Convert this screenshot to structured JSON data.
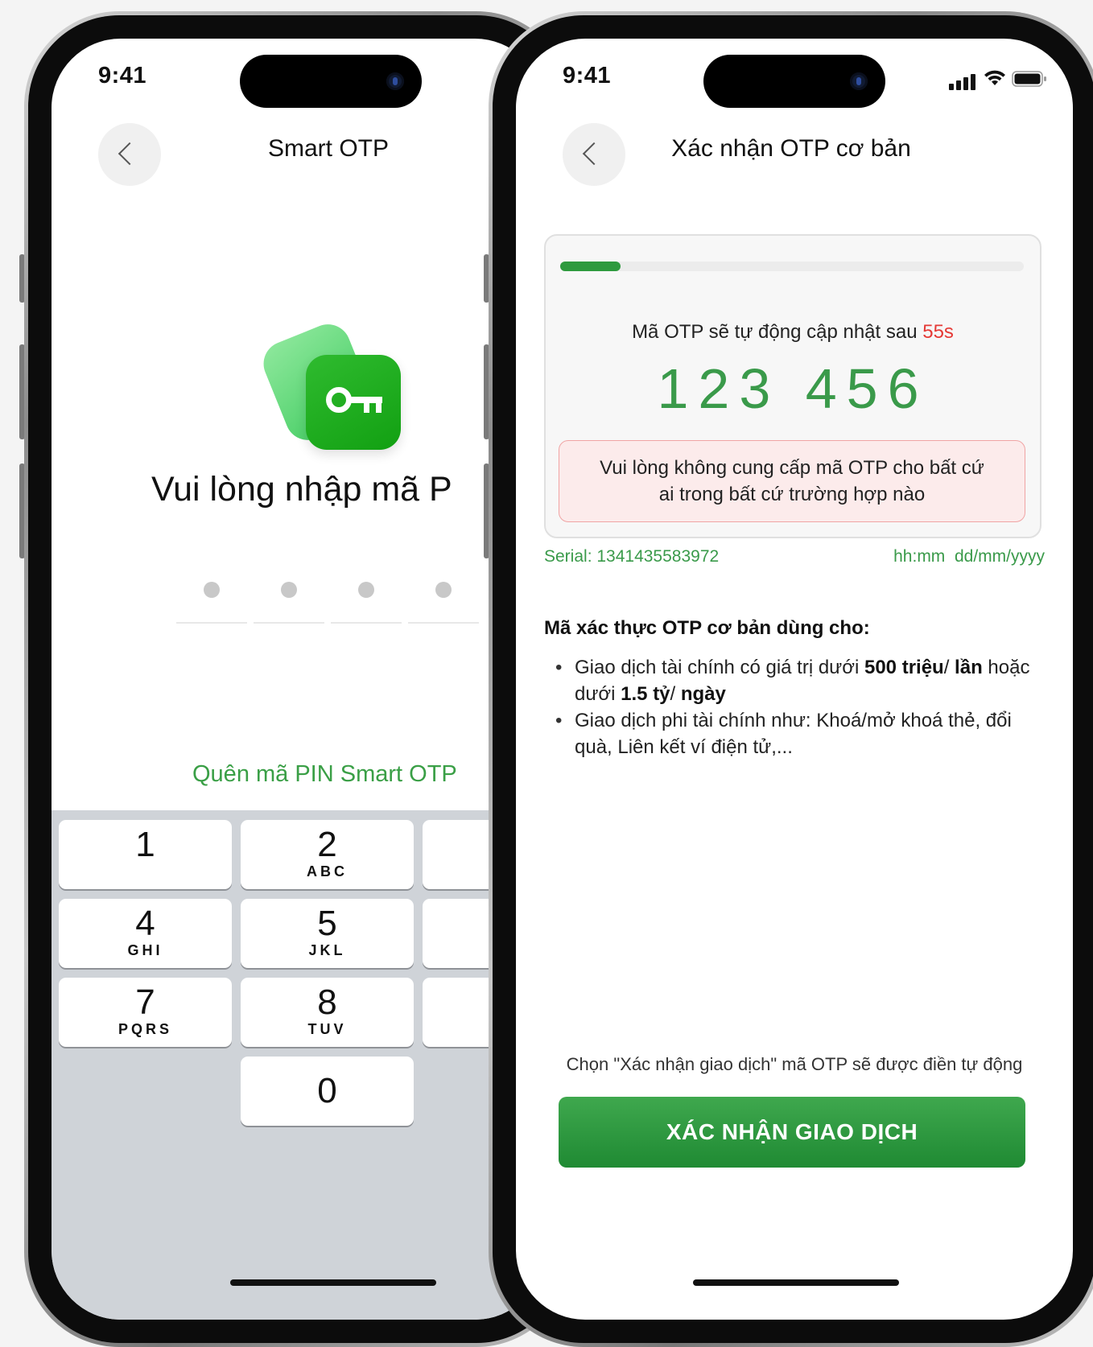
{
  "phone_left": {
    "status_time": "9:41",
    "title": "Smart OTP",
    "heading": "Vui lòng nhập mã P",
    "forgot_link": "Quên mã PIN Smart OTP",
    "keypad": [
      {
        "digit": "1",
        "letters": ""
      },
      {
        "digit": "2",
        "letters": "ABC"
      },
      {
        "digit": "4",
        "letters": "GHI"
      },
      {
        "digit": "5",
        "letters": "JKL"
      },
      {
        "digit": "7",
        "letters": "PQRS"
      },
      {
        "digit": "8",
        "letters": "TUV"
      },
      {
        "digit": "0",
        "letters": ""
      }
    ]
  },
  "phone_right": {
    "status_time": "9:41",
    "title": "Xác nhận OTP cơ bản",
    "otp_card": {
      "refresh_text": "Mã OTP sẽ tự động cập nhật sau ",
      "refresh_seconds": "55s",
      "progress_fraction": 0.13,
      "otp_code": "123 456",
      "warning_line1": "Vui lòng không cung cấp mã OTP cho bất cứ",
      "warning_line2": "ai trong bất cứ trường hợp nào"
    },
    "serial": "Serial: 1341435583972",
    "datetime_format": "hh:mm  dd/mm/yyyy",
    "usage": {
      "title": "Mã xác thực OTP cơ bản dùng cho:",
      "item1_a": "Giao dịch tài chính có giá trị dưới ",
      "item1_b": "500 triệu",
      "item1_c": "/ ",
      "item1_d": "lần",
      "item1_e": " hoặc dưới ",
      "item1_f": "1.5 tỷ",
      "item1_g": "/ ",
      "item1_h": "ngày",
      "item2": "Giao dịch phi tài chính như: Khoá/mở khoá thẻ, đổi quà, Liên kết ví điện tử,..."
    },
    "hint": "Chọn \"Xác nhận giao dịch\" mã OTP sẽ được điền tự động",
    "confirm_button": "XÁC NHẬN GIAO DỊCH"
  },
  "colors": {
    "brand_green": "#3a9a4a",
    "button_green": "#2a9a3c",
    "countdown_red": "#e53935",
    "warning_bg": "#fcebeb"
  }
}
